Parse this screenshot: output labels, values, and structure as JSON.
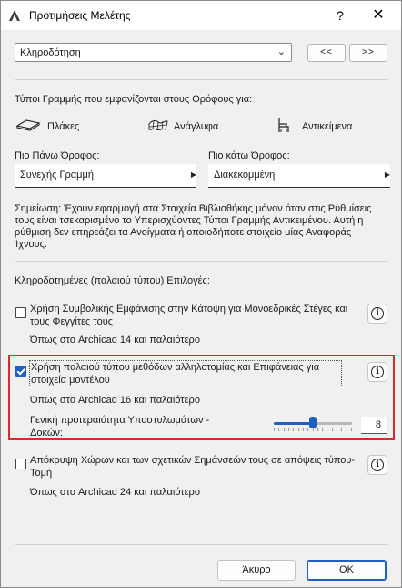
{
  "window": {
    "title": "Προτιμήσεις Μελέτης",
    "help_label": "?",
    "close_label": "✕"
  },
  "preset": {
    "selected": "Κληροδότηση",
    "prev_label": "<<",
    "next_label": ">>"
  },
  "line_types": {
    "heading": "Τύποι Γραμμής που εμφανίζονται στους Ορόφους για:",
    "items": [
      {
        "label": "Πλάκες",
        "icon": "slab-icon"
      },
      {
        "label": "Ανάγλυφα",
        "icon": "mesh-icon"
      },
      {
        "label": "Αντικείμενα",
        "icon": "object-chair-icon"
      }
    ],
    "above_label": "Πιο Πάνω Όροφος:",
    "above_value": "Συνεχής Γραμμή",
    "below_label": "Πιο κάτω Όροφος:",
    "below_value": "Διακεκομμένη",
    "note": "Σημείωση: Έχουν εφαρμογή στα Στοιχεία Βιβλιοθήκης μόνον όταν στις Ρυθμίσεις τους είναι τσεκαρισμένο το Υπερισχύοντες Τύποι Γραμμής Αντικειμένου. Αυτή η ρύθμιση δεν επηρεάζει τα Ανοίγματα ή οποιοδήποτε στοιχείο μίας Αναφοράς Ίχνους."
  },
  "legacy": {
    "heading": "Κληροδοτημένες (παλαιού τύπου) Επιλογές:",
    "opt1": {
      "label": "Χρήση Συμβολικής Εμφάνισης στην Κάτοψη για Μονοεδρικές Στέγες και τους Φεγγίτες τους",
      "note": "Όπως στο Archicad 14 και παλαιότερο",
      "checked": false
    },
    "opt2": {
      "label": "Χρήση παλαιού τύπου μεθόδων αλληλοτομίας και Επιφάνειας για στοιχεία μοντέλου",
      "note": "Όπως στο Archicad 16 και παλαιότερο",
      "checked": true,
      "priority_label": "Γενική προτεραιότητα Υποστυλωμάτων - Δοκών:",
      "priority_value": "8",
      "priority_level": 8,
      "priority_max": 16
    },
    "opt3": {
      "label": "Απόκρυψη Χώρων και των σχετικών Σημάνσεών τους σε απόψεις τύπου-Τομή",
      "note": "Όπως στο Archicad 24 και παλαιότερο",
      "checked": false
    }
  },
  "footer": {
    "cancel_label": "Άκυρο",
    "ok_label": "ΟΚ"
  },
  "colors": {
    "accent": "#1f5fc4",
    "highlight": "#e0272f"
  }
}
